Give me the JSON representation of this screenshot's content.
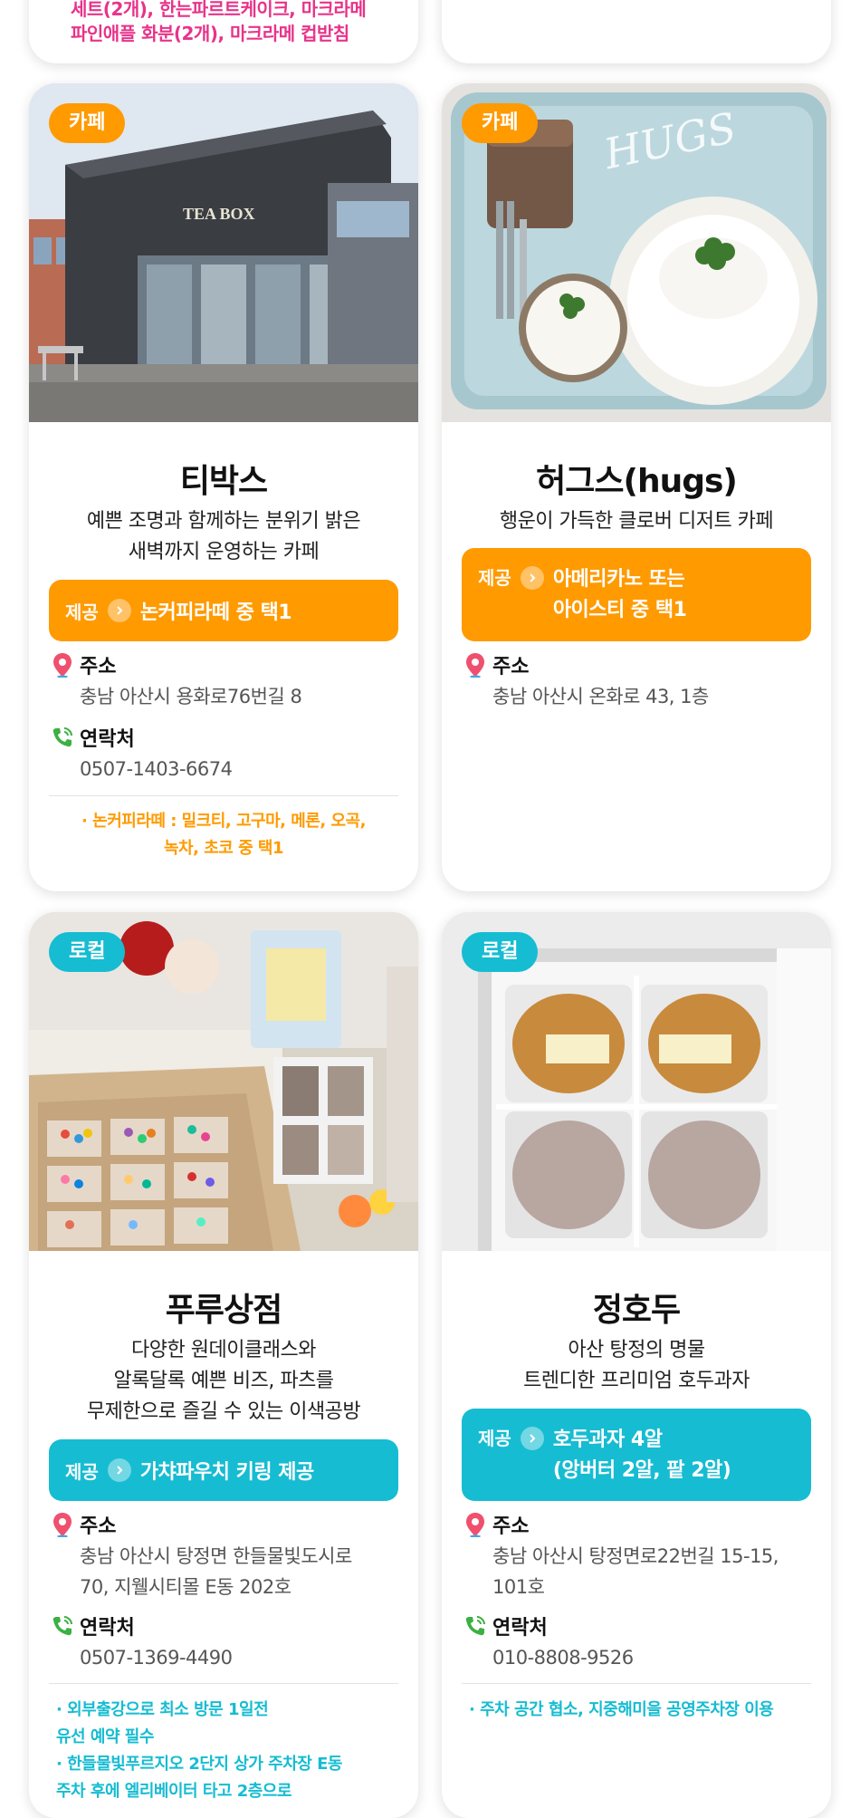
{
  "top_partial": {
    "line1": "세트(2개), 한는파르트케이크, 마크라메",
    "line2": "파인애플 화분(2개), 마크라메 컵받침"
  },
  "cards": [
    {
      "category": "카페",
      "name": "티박스",
      "desc": [
        "예쁜 조명과 함께하는 분위기 밝은",
        "새벽까지 운영하는 카페"
      ],
      "offer_label": "제공",
      "offer": [
        "논커피라떼 중 택1"
      ],
      "address_label": "주소",
      "address": [
        "충남 아산시 용화로76번길 8"
      ],
      "contact_label": "연락처",
      "contact": "0507-1403-6674",
      "notes": [
        "· 논커피라떼 : 밀크티, 고구마, 메론, 오곡,",
        "녹차, 초코 중 택1"
      ],
      "photo_sign": "TEA BOX"
    },
    {
      "category": "카페",
      "name": "허그스(hugs)",
      "desc": [
        "행운이 가득한 클로버 디저트 카페"
      ],
      "offer_label": "제공",
      "offer": [
        "아메리카노 또는",
        "아이스티 중 택1"
      ],
      "address_label": "주소",
      "address": [
        "충남 아산시 온화로 43, 1층"
      ],
      "photo_sign": "HUGS"
    },
    {
      "category": "로컬",
      "name": "푸루상점",
      "desc": [
        "다양한 원데이클래스와",
        "알록달록 예쁜 비즈, 파츠를",
        "무제한으로 즐길 수 있는 이색공방"
      ],
      "offer_label": "제공",
      "offer": [
        "가챠파우치 키링 제공"
      ],
      "address_label": "주소",
      "address": [
        "충남 아산시 탕정면 한들물빛도시로",
        "70, 지웰시티몰 E동 202호"
      ],
      "contact_label": "연락처",
      "contact": "0507-1369-4490",
      "notes": [
        "· 외부출강으로 최소 방문 1일전",
        "  유선 예약 필수",
        "· 한들물빛푸르지오 2단지 상가 주차장 E동",
        "  주차 후에 엘리베이터 타고 2층으로"
      ]
    },
    {
      "category": "로컬",
      "name": "정호두",
      "desc": [
        "아산 탕정의 명물",
        "트렌디한 프리미엄 호두과자"
      ],
      "offer_label": "제공",
      "offer": [
        "호두과자 4알",
        "(앙버터 2알, 팥 2알)"
      ],
      "address_label": "주소",
      "address": [
        "충남 아산시 탕정면로22번길 15-15,",
        "101호"
      ],
      "contact_label": "연락처",
      "contact": "010-8808-9526",
      "notes": [
        "· 주차 공간 협소, 지중해미을 공영주차장 이용"
      ]
    }
  ],
  "colors": {
    "cafe": "#ff9a00",
    "local": "#16bcd2",
    "pin": "#f0506e",
    "phone": "#3cb043"
  }
}
